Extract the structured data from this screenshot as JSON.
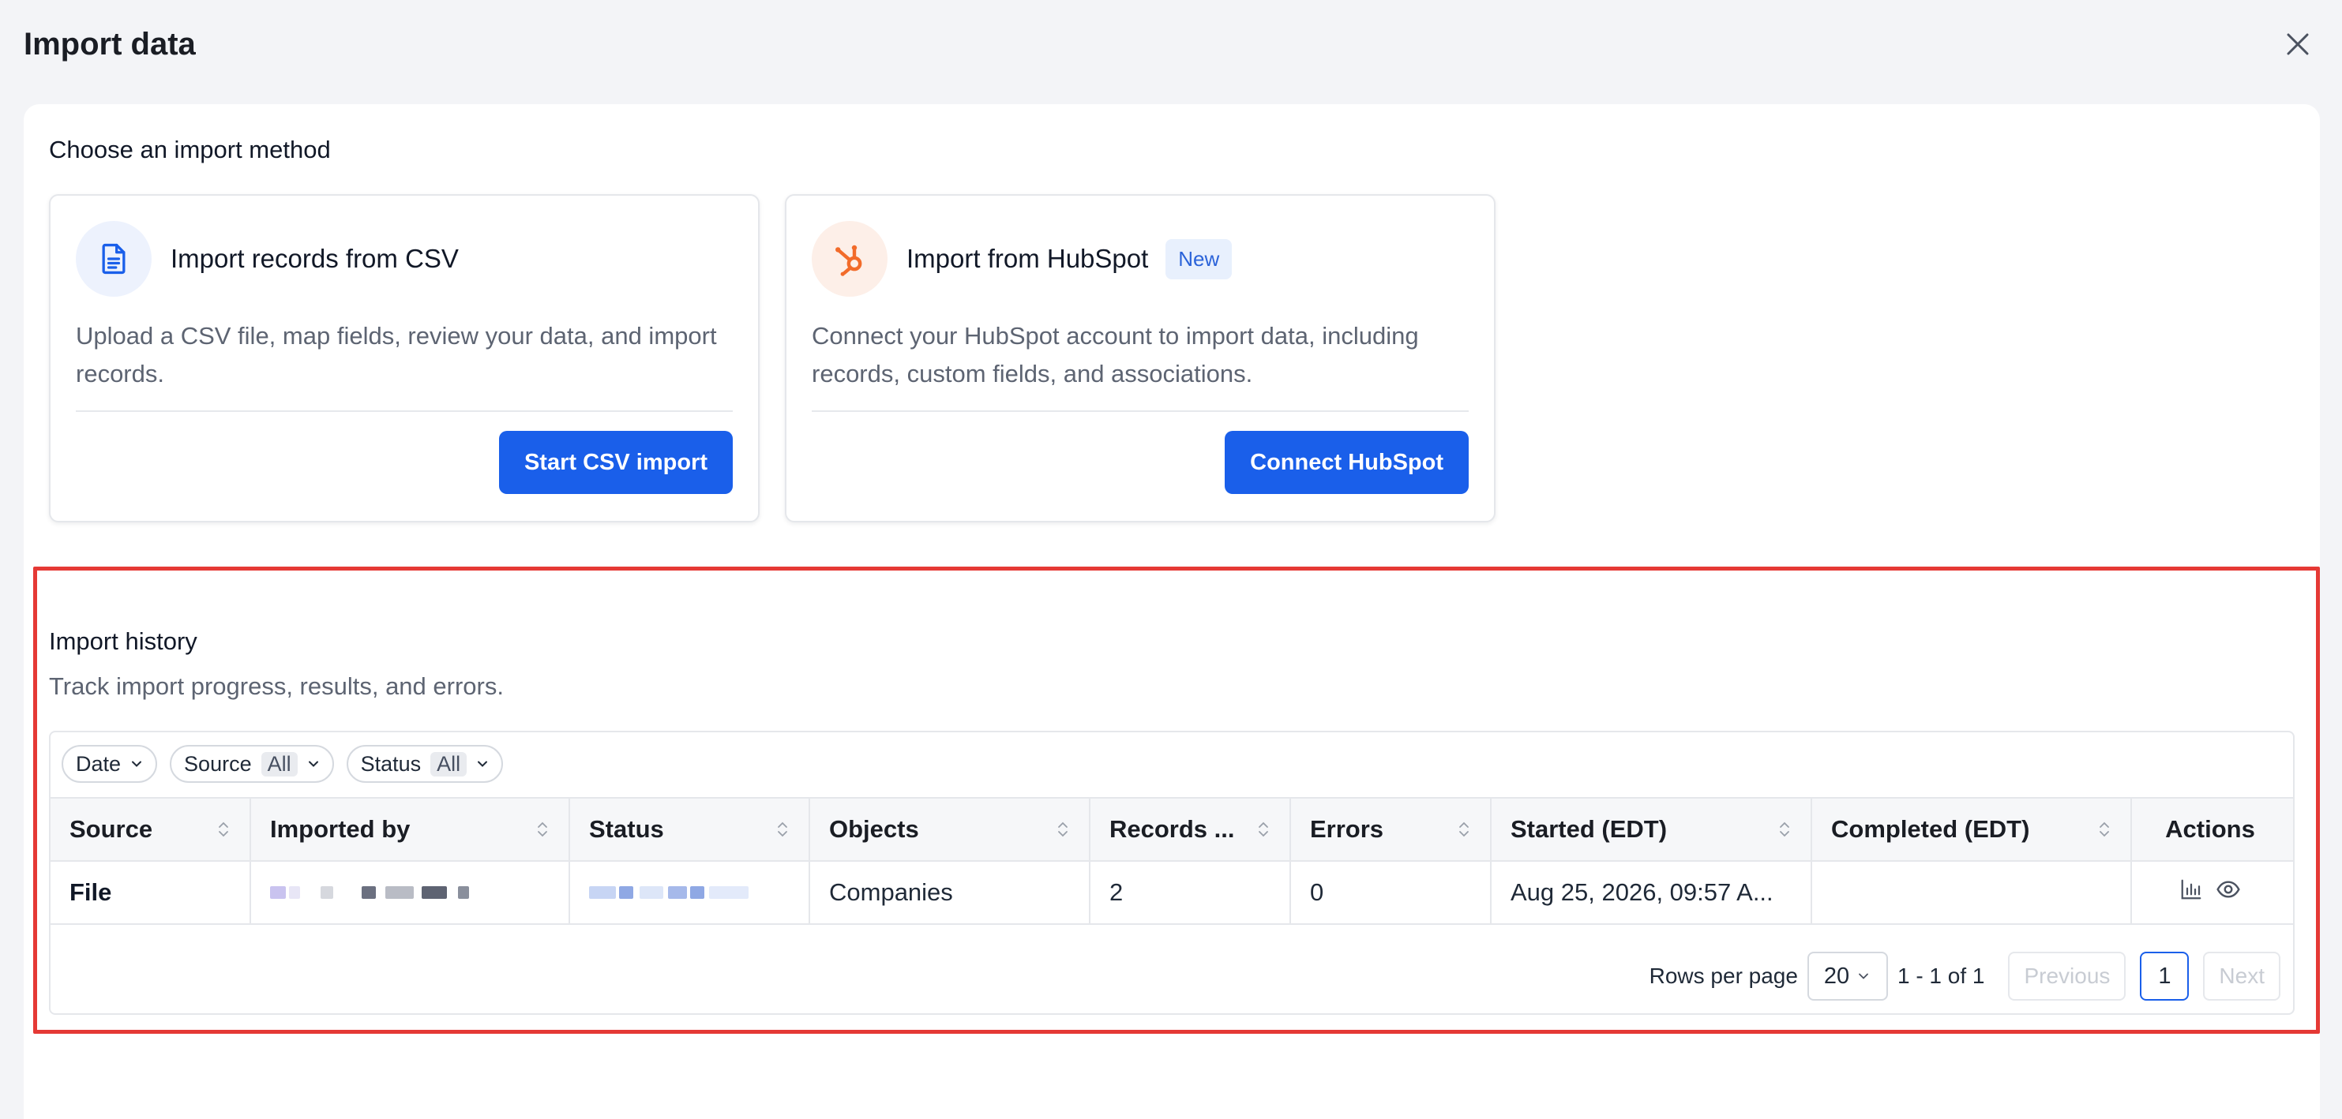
{
  "dialog": {
    "title": "Import data",
    "close_icon": "close-icon"
  },
  "import_methods": {
    "heading": "Choose an import method",
    "csv": {
      "icon": "document-icon",
      "title": "Import records from CSV",
      "description": "Upload a CSV file, map fields, review your data, and import records.",
      "button_label": "Start CSV import"
    },
    "hubspot": {
      "icon": "hubspot-icon",
      "title": "Import from HubSpot",
      "badge": "New",
      "description": "Connect your HubSpot account to import data, including records, custom fields, and associations.",
      "button_label": "Connect HubSpot"
    }
  },
  "history": {
    "title": "Import history",
    "subtitle": "Track import progress, results, and errors.",
    "filters": [
      {
        "label": "Date",
        "value": ""
      },
      {
        "label": "Source",
        "value": "All"
      },
      {
        "label": "Status",
        "value": "All"
      }
    ],
    "columns": [
      "Source",
      "Imported by",
      "Status",
      "Objects",
      "Records ...",
      "Errors",
      "Started (EDT)",
      "Completed (EDT)",
      "Actions"
    ],
    "rows": [
      {
        "source": "File",
        "imported_by": "",
        "status": "",
        "objects": "Companies",
        "records": "2",
        "errors": "0",
        "started": "Aug 25, 2026, 09:57 A...",
        "completed": ""
      }
    ],
    "pagination": {
      "rows_per_page_label": "Rows per page",
      "rows_per_page_value": "20",
      "range": "1 - 1 of 1",
      "previous_label": "Previous",
      "current_page": "1",
      "next_label": "Next"
    }
  },
  "colors": {
    "primary": "#1a5fea",
    "highlight_border": "#e53935",
    "hubspot_orange": "#f26b2a"
  }
}
